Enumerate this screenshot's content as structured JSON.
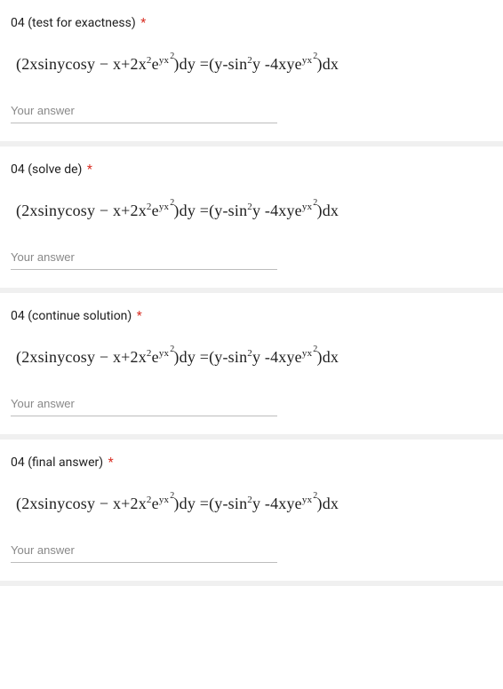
{
  "questions": [
    {
      "title": "04 (test for exactness)",
      "required": "*",
      "placeholder": "Your answer"
    },
    {
      "title": "04 (solve de)",
      "required": "*",
      "placeholder": "Your answer"
    },
    {
      "title": "04 (continue solution)",
      "required": "*",
      "placeholder": "Your answer"
    },
    {
      "title": "04 (final answer)",
      "required": "*",
      "placeholder": "Your answer"
    }
  ],
  "equation": {
    "lp": "(",
    "t1": "2xsinycosy − x+2x",
    "sq1": "2",
    "t2": "e",
    "yx1": "yx",
    "sq2": "2",
    "rp1": ")",
    "dy": "dy =",
    "lp2": "(",
    "t3": "y-sin",
    "sq3": "2",
    "t4": "y -4xye",
    "yx2": "yx",
    "sq4": "2",
    "rp2": ")",
    "dx": "dx"
  }
}
